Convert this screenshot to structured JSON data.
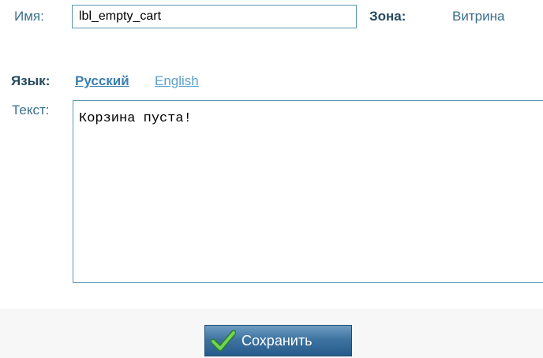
{
  "form": {
    "name_label": "Имя:",
    "name_value": "lbl_empty_cart",
    "zone_label": "Зона:",
    "zone_value": "Витрина",
    "language_label": "Язык:",
    "languages": [
      {
        "label": "Русский",
        "active": true
      },
      {
        "label": "English",
        "active": false
      }
    ],
    "text_label": "Текст:",
    "text_value": "Корзина пуста!"
  },
  "footer": {
    "save_label": "Сохранить"
  },
  "icons": {
    "save": "check-icon"
  },
  "colors": {
    "label": "#3a6f8c",
    "label_bold": "#23485e",
    "link": "#3a7fae",
    "button": "#3f74a2",
    "check": "#4fb63b"
  }
}
